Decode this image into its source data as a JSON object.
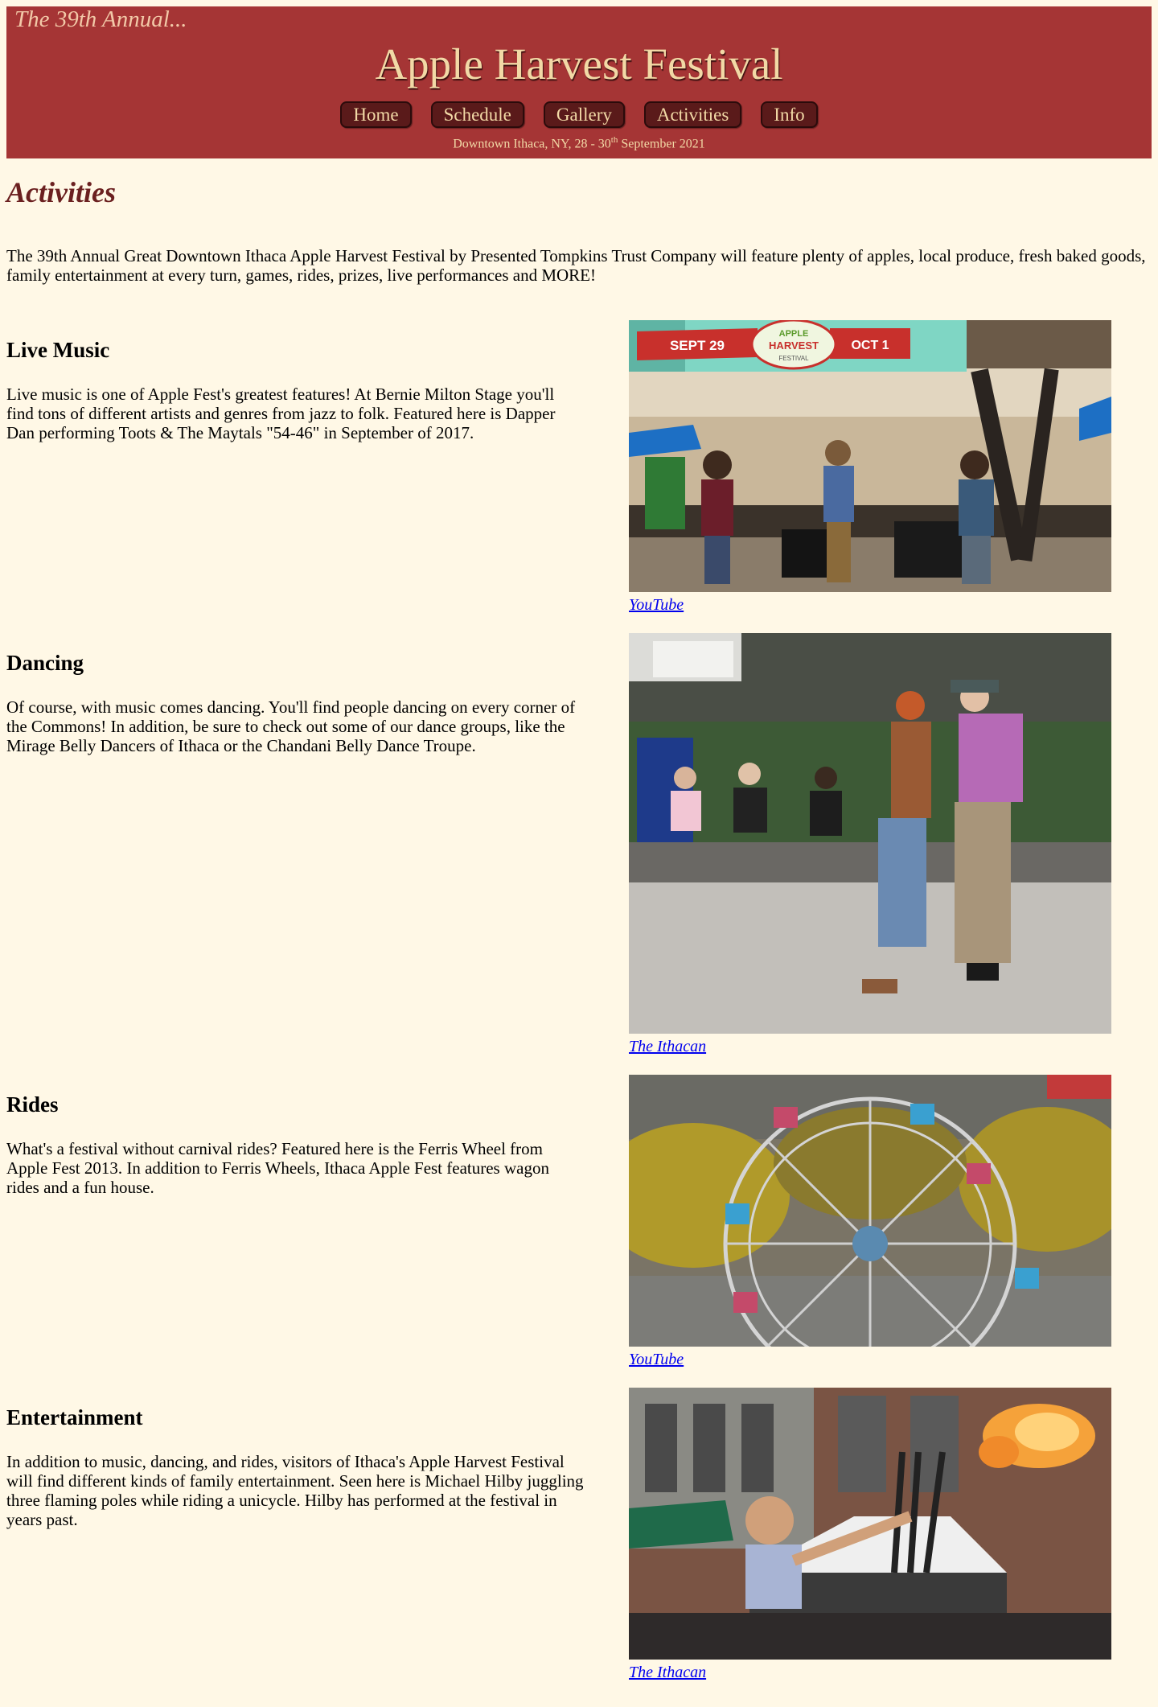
{
  "header": {
    "tagline": "The 39th Annual...",
    "title": "Apple Harvest Festival",
    "nav": [
      "Home",
      "Schedule",
      "Gallery",
      "Activities",
      "Info"
    ],
    "dateline_prefix": "Downtown Ithaca, NY, 28 - 30",
    "dateline_sup": "th",
    "dateline_suffix": " September 2021"
  },
  "page_title": "Activities",
  "intro": "The 39th Annual Great Downtown Ithaca Apple Harvest Festival by Presented Tompkins Trust Company will feature plenty of apples, local produce, fresh baked goods, family entertainment at every turn, games, rides, prizes, live performances and MORE!",
  "sections": [
    {
      "heading": "Live Music",
      "text": "Live music is one of Apple Fest's greatest features! At Bernie Milton Stage you'll find tons of different artists and genres from jazz to folk. Featured here is Dapper Dan performing Toots & The Maytals \"54-46\" in September of 2017.",
      "credit": "YouTube",
      "banner": {
        "left": "SEPT 29",
        "right": "OCT 1",
        "center1": "APPLE",
        "center2": "HARVEST",
        "center3": "FESTIVAL"
      }
    },
    {
      "heading": "Dancing",
      "text": "Of course, with music comes dancing. You'll find people dancing on every corner of the Commons! In addition, be sure to check out some of our dance groups, like the Mirage Belly Dancers of Ithaca or the Chandani Belly Dance Troupe.",
      "credit": "The Ithacan"
    },
    {
      "heading": "Rides",
      "text": "What's a festival without carnival rides? Featured here is the Ferris Wheel from Apple Fest 2013. In addition to Ferris Wheels, Ithaca Apple Fest features wagon rides and a fun house.",
      "credit": "YouTube"
    },
    {
      "heading": "Entertainment",
      "text": "In addition to music, dancing, and rides, visitors of Ithaca's Apple Harvest Festival will find different kinds of family entertainment. Seen here is Michael Hilby juggling three flaming poles while riding a unicycle. Hilby has performed at the festival in years past.",
      "credit": "The Ithacan"
    }
  ],
  "colors": {
    "background": "#fff8e6",
    "header": "#a53535",
    "nav_button": "#5a1a1a",
    "heading": "#6b2020",
    "link": "#0000ee"
  }
}
